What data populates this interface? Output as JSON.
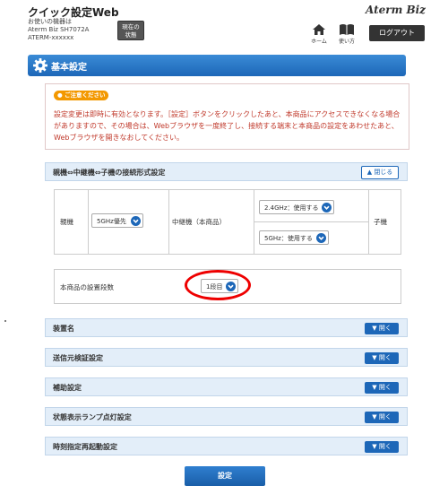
{
  "header": {
    "app_title": "クイック設定Web",
    "device_label": "お使いの機器は",
    "device_model": "Aterm Biz SH7072A",
    "device_name": "ATERM-xxxxxx",
    "status_button_line1": "現在の",
    "status_button_line2": "状態",
    "brand": "Aterm Biz",
    "home_label": "ホーム",
    "manual_label": "使い方",
    "logout_label": "ログアウト"
  },
  "page": {
    "title": "基本設定"
  },
  "notice": {
    "badge": "ご注意ください",
    "text": "設定変更は即時に有効となります。［設定］ボタンをクリックしたあと、本商品にアクセスできなくなる場合がありますので、その場合は、Webブラウザを一度終了し、接続する端末と本商品の設定をあわせたあと、Webブラウザを開きなおしてください。"
  },
  "connection_section": {
    "title": "親機⇔中継機⇔子機の接続形式設定",
    "close_label": "閉じる",
    "parent_label": "親機",
    "parent_select": "5GHz優先",
    "repeater_label": "中継機（本商品）",
    "band24_select": "2.4GHz：使用する",
    "band5_select": "5GHz：使用する",
    "child_label": "子機",
    "stage_label": "本商品の設置段数",
    "stage_select": "1段目"
  },
  "sections": [
    {
      "title": "装置名",
      "open_label": "開く"
    },
    {
      "title": "送信元検証設定",
      "open_label": "開く"
    },
    {
      "title": "補助設定",
      "open_label": "開く"
    },
    {
      "title": "状態表示ランプ点灯設定",
      "open_label": "開く"
    },
    {
      "title": "時刻指定再起動設定",
      "open_label": "開く"
    }
  ],
  "submit_label": "設定",
  "colors": {
    "accent": "#1d67b8",
    "notice_text": "#c0392b",
    "notice_badge": "#f39800",
    "highlight_oval": "#e00000"
  }
}
